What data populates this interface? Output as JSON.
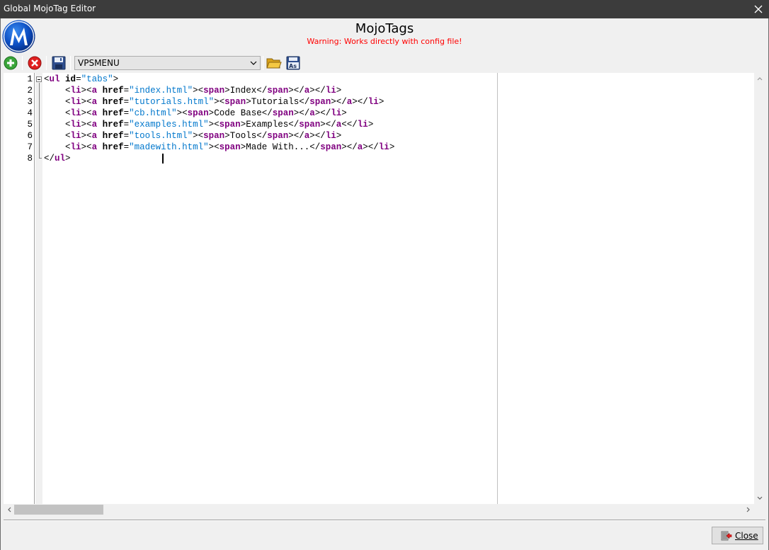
{
  "window": {
    "title": "Global MojoTag Editor"
  },
  "header": {
    "app_name": "MojoTags",
    "warning": "Warning: Works directly with config file!",
    "logo_letter": "M"
  },
  "toolbar": {
    "add_icon": "plus-circle-icon",
    "delete_icon": "x-circle-icon",
    "save_icon": "floppy-disk-icon",
    "selected_tag": "VPSMENU",
    "open_icon": "folder-open-icon",
    "save_as_icon": "save-as-icon"
  },
  "editor": {
    "line_numbers": [
      "1",
      "2",
      "3",
      "4",
      "5",
      "6",
      "7",
      "8"
    ],
    "lines": [
      [
        [
          "br",
          "<"
        ],
        [
          "tag",
          "ul"
        ],
        [
          "txt",
          " "
        ],
        [
          "attr",
          "id"
        ],
        [
          "br",
          "="
        ],
        [
          "str",
          "\"tabs\""
        ],
        [
          "br",
          ">"
        ]
      ],
      [
        [
          "txt",
          "    "
        ],
        [
          "br",
          "<"
        ],
        [
          "tag",
          "li"
        ],
        [
          "br",
          "><"
        ],
        [
          "tag",
          "a"
        ],
        [
          "txt",
          " "
        ],
        [
          "attr",
          "href"
        ],
        [
          "br",
          "="
        ],
        [
          "str",
          "\"index.html\""
        ],
        [
          "br",
          "><"
        ],
        [
          "tag",
          "span"
        ],
        [
          "br",
          ">"
        ],
        [
          "txt",
          "Index"
        ],
        [
          "br",
          "</"
        ],
        [
          "tag",
          "span"
        ],
        [
          "br",
          "></"
        ],
        [
          "tag",
          "a"
        ],
        [
          "br",
          "></"
        ],
        [
          "tag",
          "li"
        ],
        [
          "br",
          ">"
        ]
      ],
      [
        [
          "txt",
          "    "
        ],
        [
          "br",
          "<"
        ],
        [
          "tag",
          "li"
        ],
        [
          "br",
          "><"
        ],
        [
          "tag",
          "a"
        ],
        [
          "txt",
          " "
        ],
        [
          "attr",
          "href"
        ],
        [
          "br",
          "="
        ],
        [
          "str",
          "\"tutorials.html\""
        ],
        [
          "br",
          "><"
        ],
        [
          "tag",
          "span"
        ],
        [
          "br",
          ">"
        ],
        [
          "txt",
          "Tutorials"
        ],
        [
          "br",
          "</"
        ],
        [
          "tag",
          "span"
        ],
        [
          "br",
          "></"
        ],
        [
          "tag",
          "a"
        ],
        [
          "br",
          "></"
        ],
        [
          "tag",
          "li"
        ],
        [
          "br",
          ">"
        ]
      ],
      [
        [
          "txt",
          "    "
        ],
        [
          "br",
          "<"
        ],
        [
          "tag",
          "li"
        ],
        [
          "br",
          "><"
        ],
        [
          "tag",
          "a"
        ],
        [
          "txt",
          " "
        ],
        [
          "attr",
          "href"
        ],
        [
          "br",
          "="
        ],
        [
          "str",
          "\"cb.html\""
        ],
        [
          "br",
          "><"
        ],
        [
          "tag",
          "span"
        ],
        [
          "br",
          ">"
        ],
        [
          "txt",
          "Code Base"
        ],
        [
          "br",
          "</"
        ],
        [
          "tag",
          "span"
        ],
        [
          "br",
          "></"
        ],
        [
          "tag",
          "a"
        ],
        [
          "br",
          "></"
        ],
        [
          "tag",
          "li"
        ],
        [
          "br",
          ">"
        ]
      ],
      [
        [
          "txt",
          "    "
        ],
        [
          "br",
          "<"
        ],
        [
          "tag",
          "li"
        ],
        [
          "br",
          "><"
        ],
        [
          "tag",
          "a"
        ],
        [
          "txt",
          " "
        ],
        [
          "attr",
          "href"
        ],
        [
          "br",
          "="
        ],
        [
          "str",
          "\"examples.html\""
        ],
        [
          "br",
          "><"
        ],
        [
          "tag",
          "span"
        ],
        [
          "br",
          ">"
        ],
        [
          "txt",
          "Examples"
        ],
        [
          "br",
          "</"
        ],
        [
          "tag",
          "span"
        ],
        [
          "br",
          "></"
        ],
        [
          "tag",
          "a"
        ],
        [
          "br",
          "<</"
        ],
        [
          "tag",
          "li"
        ],
        [
          "br",
          ">"
        ]
      ],
      [
        [
          "txt",
          "    "
        ],
        [
          "br",
          "<"
        ],
        [
          "tag",
          "li"
        ],
        [
          "br",
          "><"
        ],
        [
          "tag",
          "a"
        ],
        [
          "txt",
          " "
        ],
        [
          "attr",
          "href"
        ],
        [
          "br",
          "="
        ],
        [
          "str",
          "\"tools.html\""
        ],
        [
          "br",
          "><"
        ],
        [
          "tag",
          "span"
        ],
        [
          "br",
          ">"
        ],
        [
          "txt",
          "Tools"
        ],
        [
          "br",
          "</"
        ],
        [
          "tag",
          "span"
        ],
        [
          "br",
          "></"
        ],
        [
          "tag",
          "a"
        ],
        [
          "br",
          "></"
        ],
        [
          "tag",
          "li"
        ],
        [
          "br",
          ">"
        ]
      ],
      [
        [
          "txt",
          "    "
        ],
        [
          "br",
          "<"
        ],
        [
          "tag",
          "li"
        ],
        [
          "br",
          "><"
        ],
        [
          "tag",
          "a"
        ],
        [
          "txt",
          " "
        ],
        [
          "attr",
          "href"
        ],
        [
          "br",
          "="
        ],
        [
          "str",
          "\"madewith.html\""
        ],
        [
          "br",
          "><"
        ],
        [
          "tag",
          "span"
        ],
        [
          "br",
          ">"
        ],
        [
          "txt",
          "Made With..."
        ],
        [
          "br",
          "</"
        ],
        [
          "tag",
          "span"
        ],
        [
          "br",
          "></"
        ],
        [
          "tag",
          "a"
        ],
        [
          "br",
          "></"
        ],
        [
          "tag",
          "li"
        ],
        [
          "br",
          ">"
        ]
      ],
      [
        [
          "br",
          "</"
        ],
        [
          "tag",
          "ul"
        ],
        [
          "br",
          ">"
        ]
      ]
    ]
  },
  "footer": {
    "close_label": "Close"
  },
  "colors": {
    "tag": "#800080",
    "string": "#0077cc",
    "warning": "#ff0000",
    "titlebar": "#3c3c3c"
  }
}
